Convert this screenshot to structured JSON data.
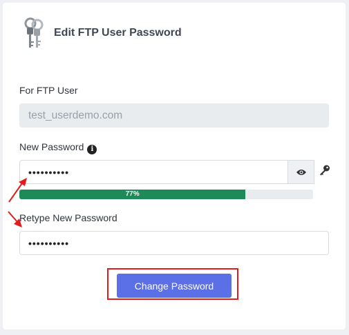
{
  "header": {
    "title": "Edit FTP User Password",
    "icon": "keys-icon"
  },
  "ftp_user": {
    "label": "For FTP User",
    "value": "test_userdemo.com"
  },
  "new_password": {
    "label": "New Password",
    "value_masked": "••••••••••",
    "info_icon": "info-icon",
    "toggle_icon": "eye-icon",
    "generate_icon": "key-icon"
  },
  "strength": {
    "percent": 77,
    "label": "77%",
    "color": "#1e8a58"
  },
  "retype_password": {
    "label": "Retype New Password",
    "value_masked": "••••••••••"
  },
  "actions": {
    "submit_label": "Change Password"
  },
  "annotation_color": "#e21b1b"
}
